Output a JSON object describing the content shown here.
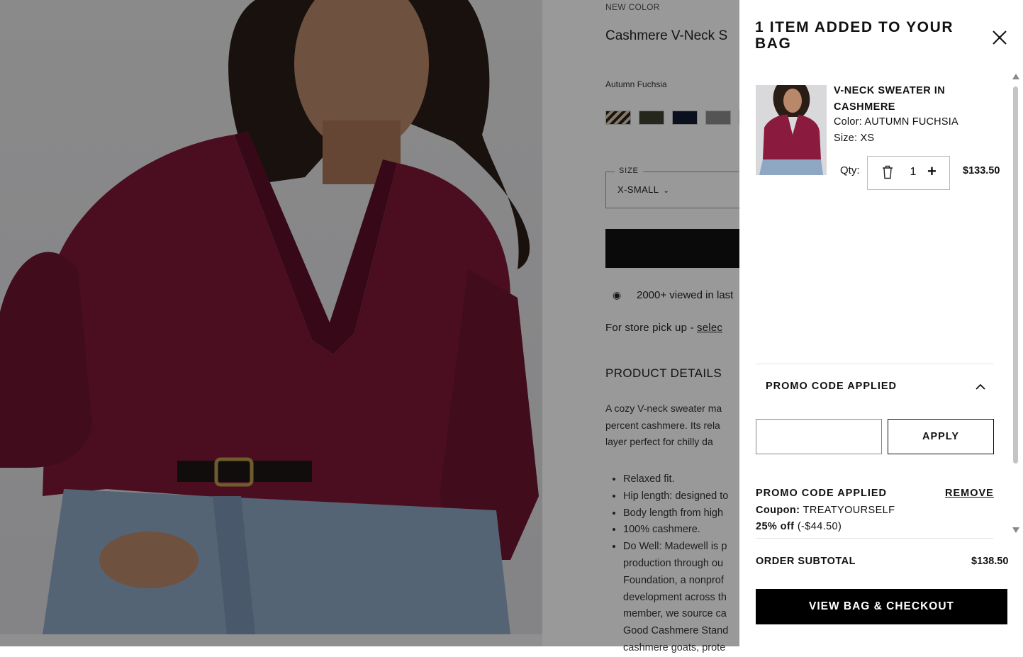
{
  "product_page": {
    "badge": "NEW COLOR",
    "title": "Cashmere V-Neck S",
    "selected_color": "Autumn Fuchsia",
    "swatches": [
      {
        "name": "stripe",
        "color": "#8b7a67"
      },
      {
        "name": "olive",
        "color": "#3f4131"
      },
      {
        "name": "navy",
        "color": "#131b33"
      },
      {
        "name": "heather-grey",
        "color": "#8c8c8c"
      },
      {
        "name": "cream",
        "color": "#d8cbb0"
      }
    ],
    "size": {
      "label": "SIZE",
      "value": "X-SMALL"
    },
    "viewed_text": "2000+ viewed in last",
    "pickup": {
      "prefix": "For store pick up - ",
      "link": "selec"
    },
    "details_heading": "PRODUCT DETAILS",
    "description_lines": [
      "A cozy V-neck sweater ma",
      "percent cashmere. Its rela",
      "layer perfect for chilly da"
    ],
    "bullets": [
      "Relaxed fit.",
      "Hip length: designed to",
      "Body length from high",
      "100% cashmere.",
      "Do Well: Madewell is p"
    ],
    "dowell_continued": [
      "production through ou",
      "Foundation, a nonprof",
      "development across th",
      "member, we source ca",
      "Good Cashmere Stand",
      "cashmere goats, prote"
    ],
    "sweater_color": "#7d1838"
  },
  "drawer": {
    "title": "1 ITEM ADDED TO YOUR BAG",
    "item": {
      "name": "V-NECK SWEATER IN CASHMERE",
      "color_label": "Color:",
      "color_value": "AUTUMN FUCHSIA",
      "size_label": "Size:",
      "size_value": "XS",
      "qty_label": "Qty:",
      "qty": "1",
      "price": "$133.50"
    },
    "promo": {
      "header": "PROMO CODE APPLIED",
      "input_placeholder": "",
      "apply_label": "APPLY",
      "applied_label": "PROMO CODE APPLIED",
      "remove_label": "REMOVE",
      "coupon_label": "Coupon:",
      "coupon_code": "TREATYOURSELF",
      "discount_label": "25% off",
      "discount_amount": "(-$44.50)"
    },
    "subtotal_label": "ORDER SUBTOTAL",
    "subtotal_value": "$138.50",
    "checkout_label": "VIEW BAG & CHECKOUT"
  },
  "colors": {
    "overlay": "rgba(0,0,0,0.40)",
    "button_black": "#000000"
  },
  "icons": [
    "close-icon",
    "trash-icon",
    "plus-icon",
    "chevron-up-icon",
    "chevron-down-icon",
    "eye-icon"
  ]
}
